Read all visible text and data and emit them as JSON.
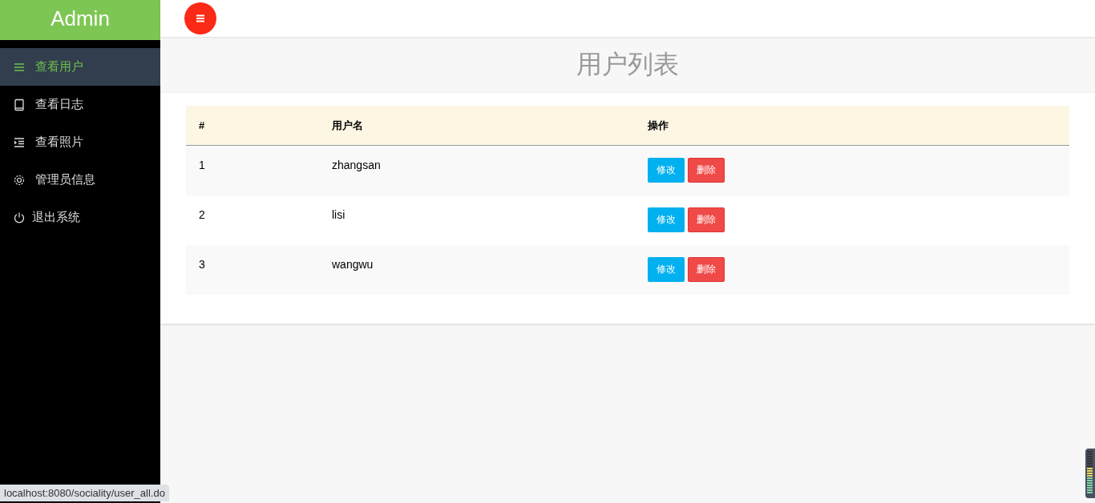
{
  "sidebar": {
    "logo": "Admin",
    "items": [
      {
        "label": "查看用户",
        "selected": true
      },
      {
        "label": "查看日志",
        "selected": false
      },
      {
        "label": "查看照片",
        "selected": false
      },
      {
        "label": "管理员信息",
        "selected": false
      },
      {
        "label": "退出系统",
        "selected": false
      }
    ]
  },
  "page_title": "用户列表",
  "table": {
    "columns": [
      "#",
      "用户名",
      "操作"
    ],
    "rows": [
      {
        "id": "1",
        "username": "zhangsan",
        "actions": [
          "修改",
          "删除"
        ]
      },
      {
        "id": "2",
        "username": "lisi",
        "actions": [
          "修改",
          "删除"
        ]
      },
      {
        "id": "3",
        "username": "wangwu",
        "actions": [
          "修改",
          "删除"
        ]
      }
    ]
  },
  "status_bar": "localhost:8080/sociality/user_all.do"
}
